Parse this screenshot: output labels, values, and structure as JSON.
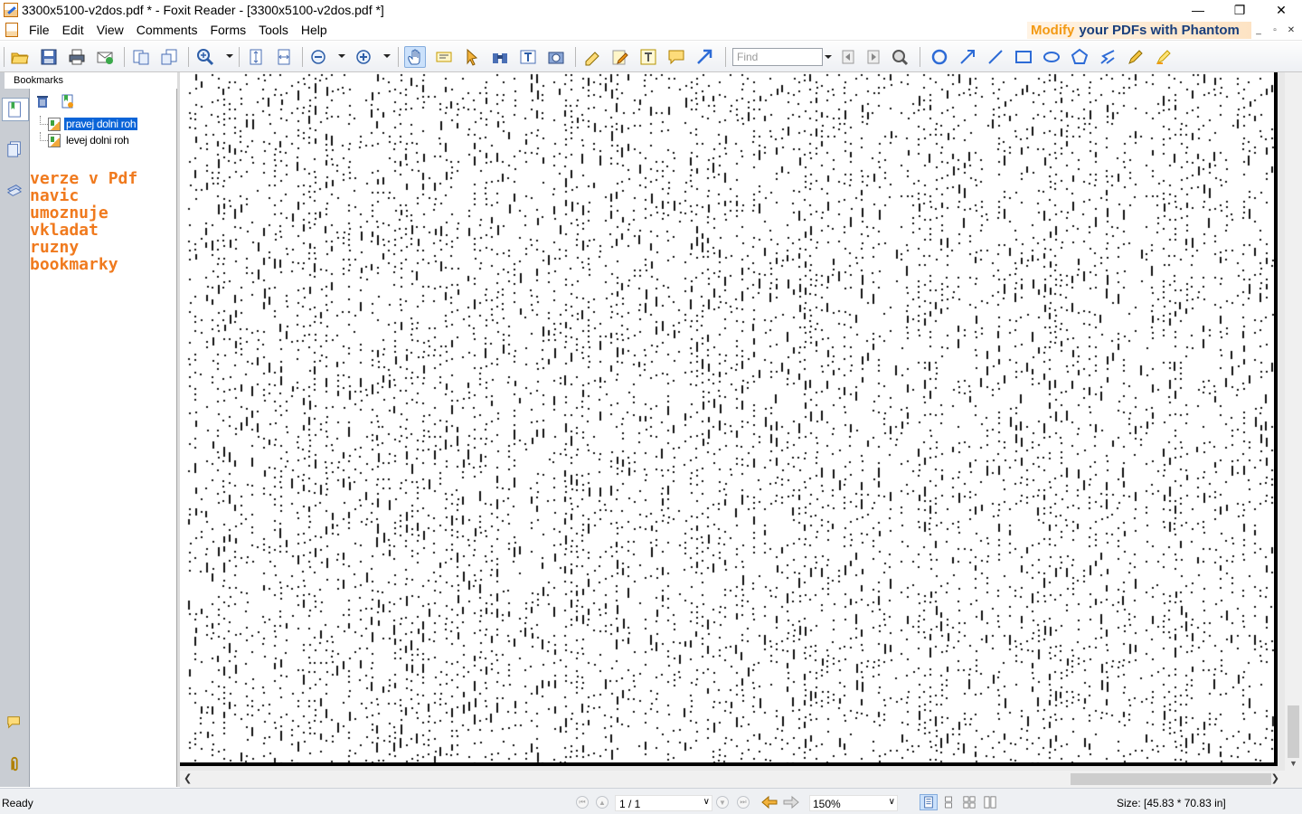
{
  "window": {
    "title": "3300x5100-v2dos.pdf * - Foxit Reader - [3300x5100-v2dos.pdf *]",
    "controls": {
      "minimize": "—",
      "restore": "❐",
      "close": "✕"
    }
  },
  "menu": {
    "items": [
      "File",
      "Edit",
      "View",
      "Comments",
      "Forms",
      "Tools",
      "Help"
    ],
    "promo_part1": "Modify",
    "promo_part2": "your PDFs with Phantom",
    "mdi": {
      "minimize": "_",
      "restore": "▫",
      "close": "✕"
    }
  },
  "toolbar": {
    "find_placeholder": "Find"
  },
  "sidebar": {
    "panel_title": "Bookmarks",
    "collapse_glyph": "◂◂",
    "bookmarks": [
      {
        "label": "pravej dolni roh",
        "selected": true
      },
      {
        "label": "levej dolni roh",
        "selected": false
      }
    ],
    "annotation": "verze v Pdf\nnavic\numoznuje\nvkladat\nruzny\nbookmarky"
  },
  "status": {
    "text": "Ready",
    "page": "1 / 1",
    "zoom": "150%",
    "size": "Size: [45.83 * 70.83 in]"
  },
  "colors": {
    "accent": "#0a64d8",
    "annotation": "#f07a1e",
    "promo_orange": "#f39a14",
    "promo_blue": "#1a3f7c"
  }
}
